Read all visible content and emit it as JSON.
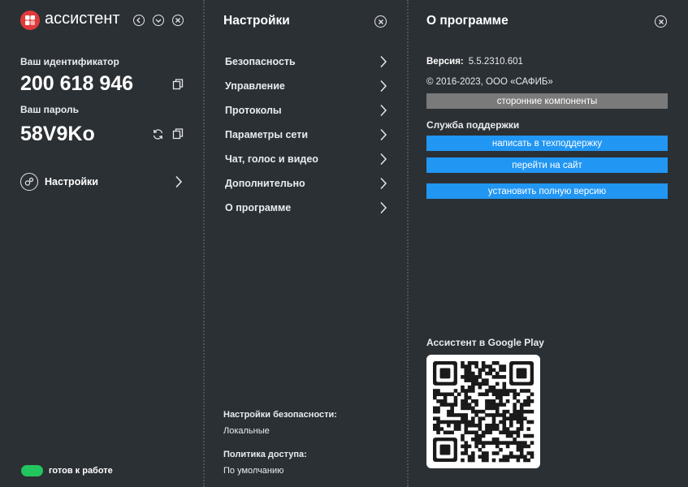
{
  "app": {
    "name": "ассистент",
    "identifier_label": "Ваш идентификатор",
    "identifier": "200 618 946",
    "password_label": "Ваш пароль",
    "password": "58V9Ko",
    "settings_label": "Настройки",
    "status_text": "готов к работе",
    "status_color": "#22c55e",
    "logo_color": "#e03a3a"
  },
  "settings_panel": {
    "title": "Настройки",
    "items": [
      {
        "label": "Безопасность"
      },
      {
        "label": "Управление"
      },
      {
        "label": "Протоколы"
      },
      {
        "label": "Параметры сети"
      },
      {
        "label": "Чат, голос и видео"
      },
      {
        "label": "Дополнительно"
      },
      {
        "label": "О программе"
      }
    ],
    "security_settings_label": "Настройки безопасности:",
    "security_settings_value": "Локальные",
    "access_policy_label": "Политика доступа:",
    "access_policy_value": "По умолчанию"
  },
  "about_panel": {
    "title": "О программе",
    "version_label": "Версия:",
    "version_value": "5.5.2310.601",
    "copyright": "© 2016-2023, ООО «САФИБ»",
    "third_party_button": "сторонние компоненты",
    "support_label": "Служба поддержки",
    "support_button": "написать в техподдержку",
    "website_button": "перейти на сайт",
    "install_button": "установить полную версию",
    "google_play_label": "Ассистент в Google Play",
    "accent_color": "#2196f3"
  }
}
